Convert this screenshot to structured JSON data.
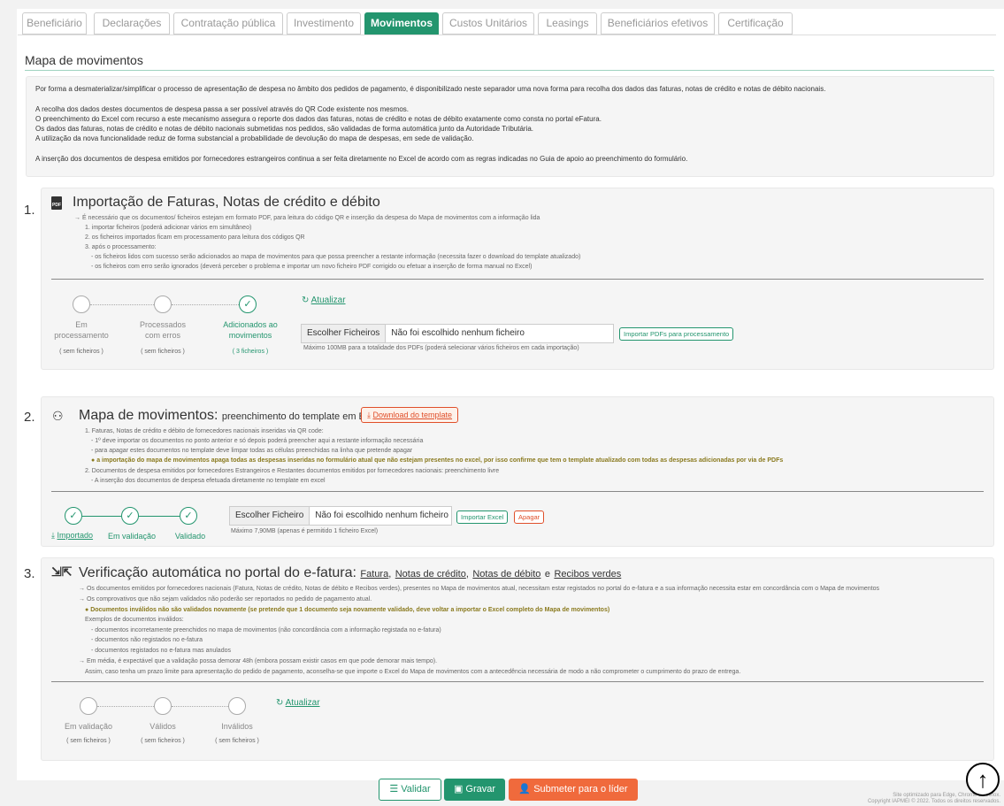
{
  "tabs": [
    "Beneficiário",
    "Declarações",
    "Contratação pública",
    "Investimento",
    "Movimentos",
    "Custos Unitários",
    "Leasings",
    "Beneficiários efetivos",
    "Certificação"
  ],
  "page_title": "Mapa de movimentos",
  "info": [
    "Por forma a desmaterializar/simplificar o processo de apresentação de despesa no âmbito dos pedidos de pagamento, é disponibilizado neste separador uma nova forma para recolha dos dados das faturas, notas de crédito e notas de débito nacionais.",
    "",
    "A recolha dos dados destes documentos de despesa passa a ser possível através do QR Code existente nos mesmos.",
    "O preenchimento do Excel com recurso a este mecanismo assegura o reporte dos dados das faturas, notas de crédito e notas de débito exatamente como consta no portal eFatura.",
    "Os dados das faturas, notas de crédito e notas de débito nacionais submetidas nos pedidos, são validadas de forma automática junto da Autoridade Tributária.",
    "A utilização da nova funcionalidade reduz de forma substancial a probabilidade de devolução do mapa de despesas, em sede de validação.",
    "",
    "A inserção dos documentos de despesa emitidos por fornecedores estrangeiros continua a ser feita diretamente no Excel de acordo com as regras indicadas no Guia de apoio ao preenchimento do formulário."
  ],
  "s1": {
    "num": "1.",
    "title": "Importação de Faturas, Notas de crédito e débito",
    "lines": [
      "→ É necessário que os documentos/ ficheiros estejam em formato PDF, para leitura do código QR e inserção da despesa do Mapa de movimentos com a informação lida",
      "1. importar ficheiros (poderá adicionar vários em simultâneo)",
      "2. os ficheiros importados ficam em processamento para leitura dos códigos QR",
      "3. após o processamento:",
      "- os ficheiros lidos com sucesso serão adicionados ao mapa de movimentos para que possa preencher a restante informação (necessita fazer o download do template atualizado)",
      "- os ficheiros com erro serão ignorados (deverá perceber o problema e importar um novo ficheiro PDF corrigido ou efetuar a inserção de forma manual no Excel)"
    ],
    "steps": [
      {
        "l1": "Em",
        "l2": "processamento",
        "count": "( sem ficheiros )"
      },
      {
        "l1": "Processados",
        "l2": "com erros",
        "count": "( sem ficheiros )"
      },
      {
        "l1": "Adicionados ao",
        "l2": "movimentos",
        "count": "( 3 ficheiros )"
      }
    ],
    "refresh": "Atualizar",
    "file_btn": "Escolher Ficheiros",
    "file_txt": "Não foi escolhido nenhum ficheiro",
    "import_btn": "Importar PDFs para processamento",
    "hint": "Máximo 100MB para a totalidade dos PDFs (poderá selecionar vários ficheiros em cada importação)"
  },
  "s2": {
    "num": "2.",
    "title": "Mapa de movimentos:",
    "subtitle": "preenchimento do template em Excel",
    "download": "Download do template",
    "lines": [
      "1. Faturas, Notas de crédito e débito de fornecedores nacionais inseridas via QR code:",
      "- 1º deve importar os documentos no ponto anterior e só depois poderá preencher aqui a restante informação necessária",
      "- para apagar estes documentos no template deve limpar todas as células preenchidas na linha que pretende apagar",
      "a importação do mapa de movimentos apaga todas as despesas inseridas no formulário atual que não estejam presentes no excel, por isso confirme que tem o template atualizado com todas as despesas adicionadas por via de PDFs",
      "2. Documentos de despesa emitidos por fornecedores Estrangeiros e Restantes documentos emitidos por fornecedores nacionais: preenchimento livre",
      "- A inserção dos documentos de despesa efetuada diretamente no template em excel"
    ],
    "steps": [
      "Importado",
      "Em validação",
      "Validado"
    ],
    "file_btn": "Escolher Ficheiro",
    "file_txt": "Não foi escolhido nenhum ficheiro",
    "import_btn": "Importar Excel",
    "delete_btn": "Apagar",
    "hint": "Máximo 7,90MB (apenas é permitido 1 ficheiro Excel)"
  },
  "s3": {
    "num": "3.",
    "title": "Verificação automática no portal do e-fatura:",
    "links": [
      "Fatura",
      "Notas de crédito",
      "Notas de débito",
      "Recibos verdes"
    ],
    "seps": [
      ",",
      ",",
      "e"
    ],
    "lines": [
      "→ Os documentos emitidos por fornecedores nacionais (Fatura, Notas de crédito, Notas de débito e Recibos verdes), presentes no Mapa de movimentos atual, necessitam estar registados no portal do e-fatura e a sua informação necessita estar em concordância com o Mapa de movimentos",
      "→ Os comprovativos que não sejam validados não poderão ser reportados no pedido de pagamento atual.",
      "Documentos inválidos não são validados novamente (se pretende que 1 documento seja novamente validado, deve voltar a importar o Excel completo do Mapa de movimentos)",
      "Exemplos de documentos inválidos:",
      "- documentos incorretamente preenchidos no mapa de movimentos (não concordância com a informação registada no e-fatura)",
      "- documentos não registados no e-fatura",
      "- documentos registados no e-fatura mas anulados",
      "→ Em média, é expectável que a validação possa demorar 48h (embora possam existir casos em que pode demorar mais tempo).",
      "Assim, caso tenha um prazo limite para apresentação do pedido de pagamento, aconselha-se que importe o Excel do Mapa de movimentos com a antecedência necessária de modo a não comprometer o cumprimento do prazo de entrega."
    ],
    "steps": [
      {
        "l1": "Em validação",
        "count": "( sem ficheiros )"
      },
      {
        "l1": "Válidos",
        "count": "( sem ficheiros )"
      },
      {
        "l1": "Inválidos",
        "count": "( sem ficheiros )"
      }
    ],
    "refresh": "Atualizar"
  },
  "buttons": {
    "validate": "Validar",
    "save": "Gravar",
    "submit": "Submeter para o líder"
  },
  "footer": [
    "Site optimizado para Edge, Chrome e Firefox.",
    "Copyright IAPMEI © 2022. Todos os direitos reservados."
  ],
  "colors": {
    "accent": "#23956e",
    "danger": "#e04f2a",
    "warning": "#8a7a1f"
  }
}
